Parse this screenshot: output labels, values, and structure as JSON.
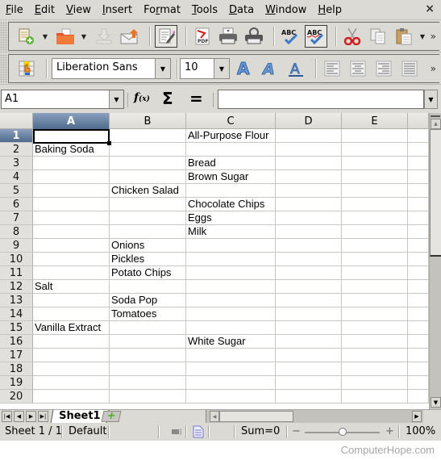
{
  "menubar": {
    "items": [
      {
        "label": "File",
        "u": "F",
        "rest": "ile"
      },
      {
        "label": "Edit",
        "u": "E",
        "rest": "dit"
      },
      {
        "label": "View",
        "u": "V",
        "rest": "iew"
      },
      {
        "label": "Insert",
        "u": "I",
        "rest": "nsert"
      },
      {
        "label": "Format",
        "pre": "Fo",
        "u": "r",
        "rest": "mat"
      },
      {
        "label": "Tools",
        "u": "T",
        "rest": "ools"
      },
      {
        "label": "Data",
        "u": "D",
        "rest": "ata"
      },
      {
        "label": "Window",
        "u": "W",
        "rest": "indow"
      },
      {
        "label": "Help",
        "u": "H",
        "rest": "elp"
      }
    ],
    "close_glyph": "×"
  },
  "toolbar_standard": {
    "buttons": [
      "new-document",
      "open",
      "save",
      "email",
      "edit-mode",
      "export-pdf",
      "print",
      "print-preview",
      "spellcheck",
      "autospellcheck",
      "cut",
      "copy",
      "paste"
    ],
    "more_glyph": "»"
  },
  "toolbar_formatting": {
    "font_name": "Liberation Sans",
    "font_size": "10",
    "buttons": [
      "bold",
      "italic",
      "underline",
      "align-left",
      "align-center",
      "align-right",
      "justify"
    ],
    "more_glyph": "»"
  },
  "formula_bar": {
    "name_box": "A1",
    "function_wizard": "f(x)",
    "sum_glyph": "Σ",
    "equals_glyph": "=",
    "input_value": ""
  },
  "sheet": {
    "columns": [
      "A",
      "B",
      "C",
      "D",
      "E"
    ],
    "selected_cell": "A1",
    "rows": [
      {
        "n": "1",
        "cells": [
          "",
          "",
          "All-Purpose Flour",
          "",
          ""
        ]
      },
      {
        "n": "2",
        "cells": [
          "Baking Soda",
          "",
          "",
          "",
          ""
        ]
      },
      {
        "n": "3",
        "cells": [
          "",
          "",
          "Bread",
          "",
          ""
        ]
      },
      {
        "n": "4",
        "cells": [
          "",
          "",
          "Brown Sugar",
          "",
          ""
        ]
      },
      {
        "n": "5",
        "cells": [
          "",
          "Chicken Salad",
          "",
          "",
          ""
        ]
      },
      {
        "n": "6",
        "cells": [
          "",
          "",
          "Chocolate Chips",
          "",
          ""
        ]
      },
      {
        "n": "7",
        "cells": [
          "",
          "",
          "Eggs",
          "",
          ""
        ]
      },
      {
        "n": "8",
        "cells": [
          "",
          "",
          "Milk",
          "",
          ""
        ]
      },
      {
        "n": "9",
        "cells": [
          "",
          "Onions",
          "",
          "",
          ""
        ]
      },
      {
        "n": "10",
        "cells": [
          "",
          "Pickles",
          "",
          "",
          ""
        ]
      },
      {
        "n": "11",
        "cells": [
          "",
          "Potato Chips",
          "",
          "",
          ""
        ]
      },
      {
        "n": "12",
        "cells": [
          "Salt",
          "",
          "",
          "",
          ""
        ]
      },
      {
        "n": "13",
        "cells": [
          "",
          "Soda Pop",
          "",
          "",
          ""
        ]
      },
      {
        "n": "14",
        "cells": [
          "",
          "Tomatoes",
          "",
          "",
          ""
        ]
      },
      {
        "n": "15",
        "cells": [
          "Vanilla Extract",
          "",
          "",
          "",
          ""
        ]
      },
      {
        "n": "16",
        "cells": [
          "",
          "",
          "White Sugar",
          "",
          ""
        ]
      },
      {
        "n": "17",
        "cells": [
          "",
          "",
          "",
          "",
          ""
        ]
      },
      {
        "n": "18",
        "cells": [
          "",
          "",
          "",
          "",
          ""
        ]
      },
      {
        "n": "19",
        "cells": [
          "",
          "",
          "",
          "",
          ""
        ]
      },
      {
        "n": "20",
        "cells": [
          "",
          "",
          "",
          "",
          ""
        ]
      }
    ]
  },
  "tabs": {
    "sheets": [
      "Sheet1"
    ],
    "add_glyph": "+"
  },
  "statusbar": {
    "sheet_pos": "Sheet 1 / 1",
    "page_style": "Default",
    "sum": "Sum=0",
    "zoom_minus": "−",
    "zoom_plus": "+",
    "zoom": "100%",
    "zoom_slider_fraction": 0.5
  },
  "watermark": "ComputerHope.com",
  "colors": {
    "chrome": "#dcdad5",
    "selected_header": "#4e6a8d",
    "grid_line": "#c9c7c2"
  }
}
